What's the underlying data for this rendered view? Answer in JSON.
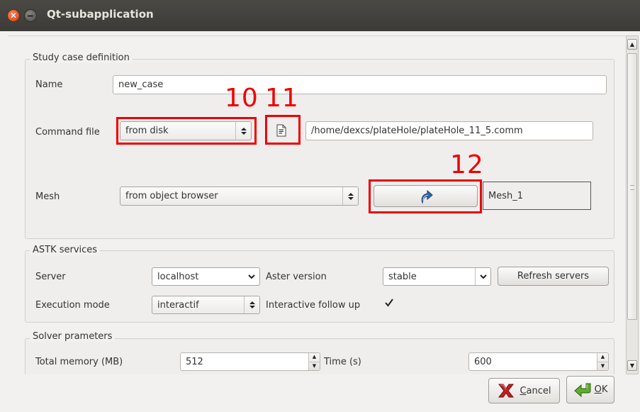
{
  "window": {
    "title": "Qt-subapplication",
    "close_glyph": "✕"
  },
  "study_case": {
    "group_title": "Study case definition",
    "name_label": "Name",
    "name_value": "new_case",
    "command_label": "Command file",
    "command_source": "from disk",
    "command_path": "/home/dexcs/plateHole/plateHole_11_5.comm",
    "mesh_label": "Mesh",
    "mesh_source": "from object browser",
    "mesh_value": "Mesh_1",
    "file_icon": "document-icon",
    "select_icon": "curved-arrow-icon"
  },
  "astk": {
    "group_title": "ASTK services",
    "server_label": "Server",
    "server_value": "localhost",
    "aster_version_label": "Aster version",
    "aster_version_value": "stable",
    "refresh_label": "Refresh servers",
    "exec_mode_label": "Execution mode",
    "exec_mode_value": "interactif",
    "follow_up_label": "Interactive follow up",
    "follow_up_checked": true
  },
  "solver": {
    "group_title": "Solver prameters",
    "memory_label": "Total memory (MB)",
    "memory_value": "512",
    "time_label": "Time (s)",
    "time_value": "600"
  },
  "buttons": {
    "cancel_mnemonic": "C",
    "cancel_rest": "ancel",
    "ok_mnemonic": "O",
    "ok_rest": "K"
  },
  "annotations": {
    "a10": "10",
    "a11": "11",
    "a12": "12"
  },
  "colors": {
    "annotation": "#ee0000",
    "titlebar": "#3c3b37",
    "close_button": "#e05a2c"
  }
}
